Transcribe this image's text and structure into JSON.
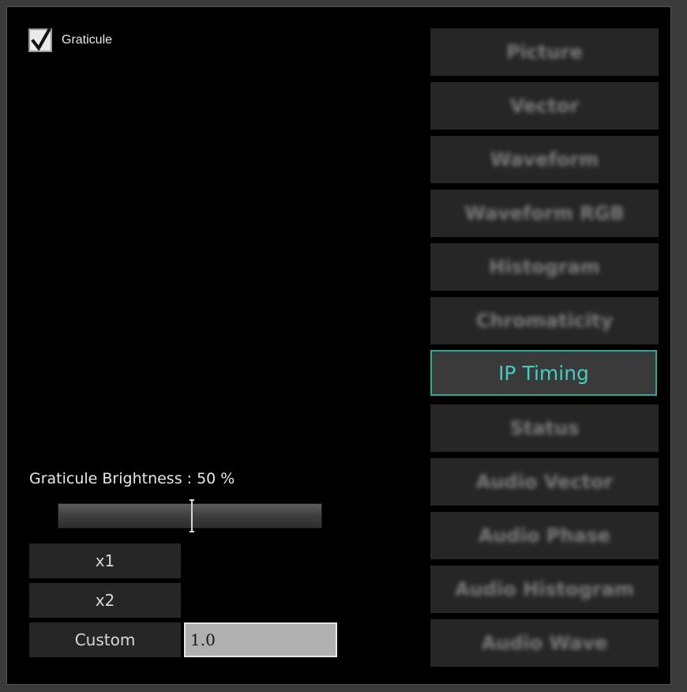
{
  "graticule": {
    "label": "Graticule",
    "checked": true
  },
  "modes": [
    {
      "label": "Picture",
      "active": false
    },
    {
      "label": "Vector",
      "active": false
    },
    {
      "label": "Waveform",
      "active": false
    },
    {
      "label": "Waveform RGB",
      "active": false
    },
    {
      "label": "Histogram",
      "active": false
    },
    {
      "label": "Chromaticity",
      "active": false
    },
    {
      "label": "IP Timing",
      "active": true
    },
    {
      "label": "Status",
      "active": false
    },
    {
      "label": "Audio Vector",
      "active": false
    },
    {
      "label": "Audio Phase",
      "active": false
    },
    {
      "label": "Audio Histogram",
      "active": false
    },
    {
      "label": "Audio Wave",
      "active": false
    }
  ],
  "brightness": {
    "label": "Graticule Brightness : 50 %",
    "value_percent": 50
  },
  "zoom": {
    "x1_label": "x1",
    "x2_label": "x2",
    "custom_label": "Custom",
    "custom_value": "1.0"
  },
  "colors": {
    "accent": "#2fa89a",
    "accent_text": "#3fd0c0",
    "background": "#000000"
  }
}
